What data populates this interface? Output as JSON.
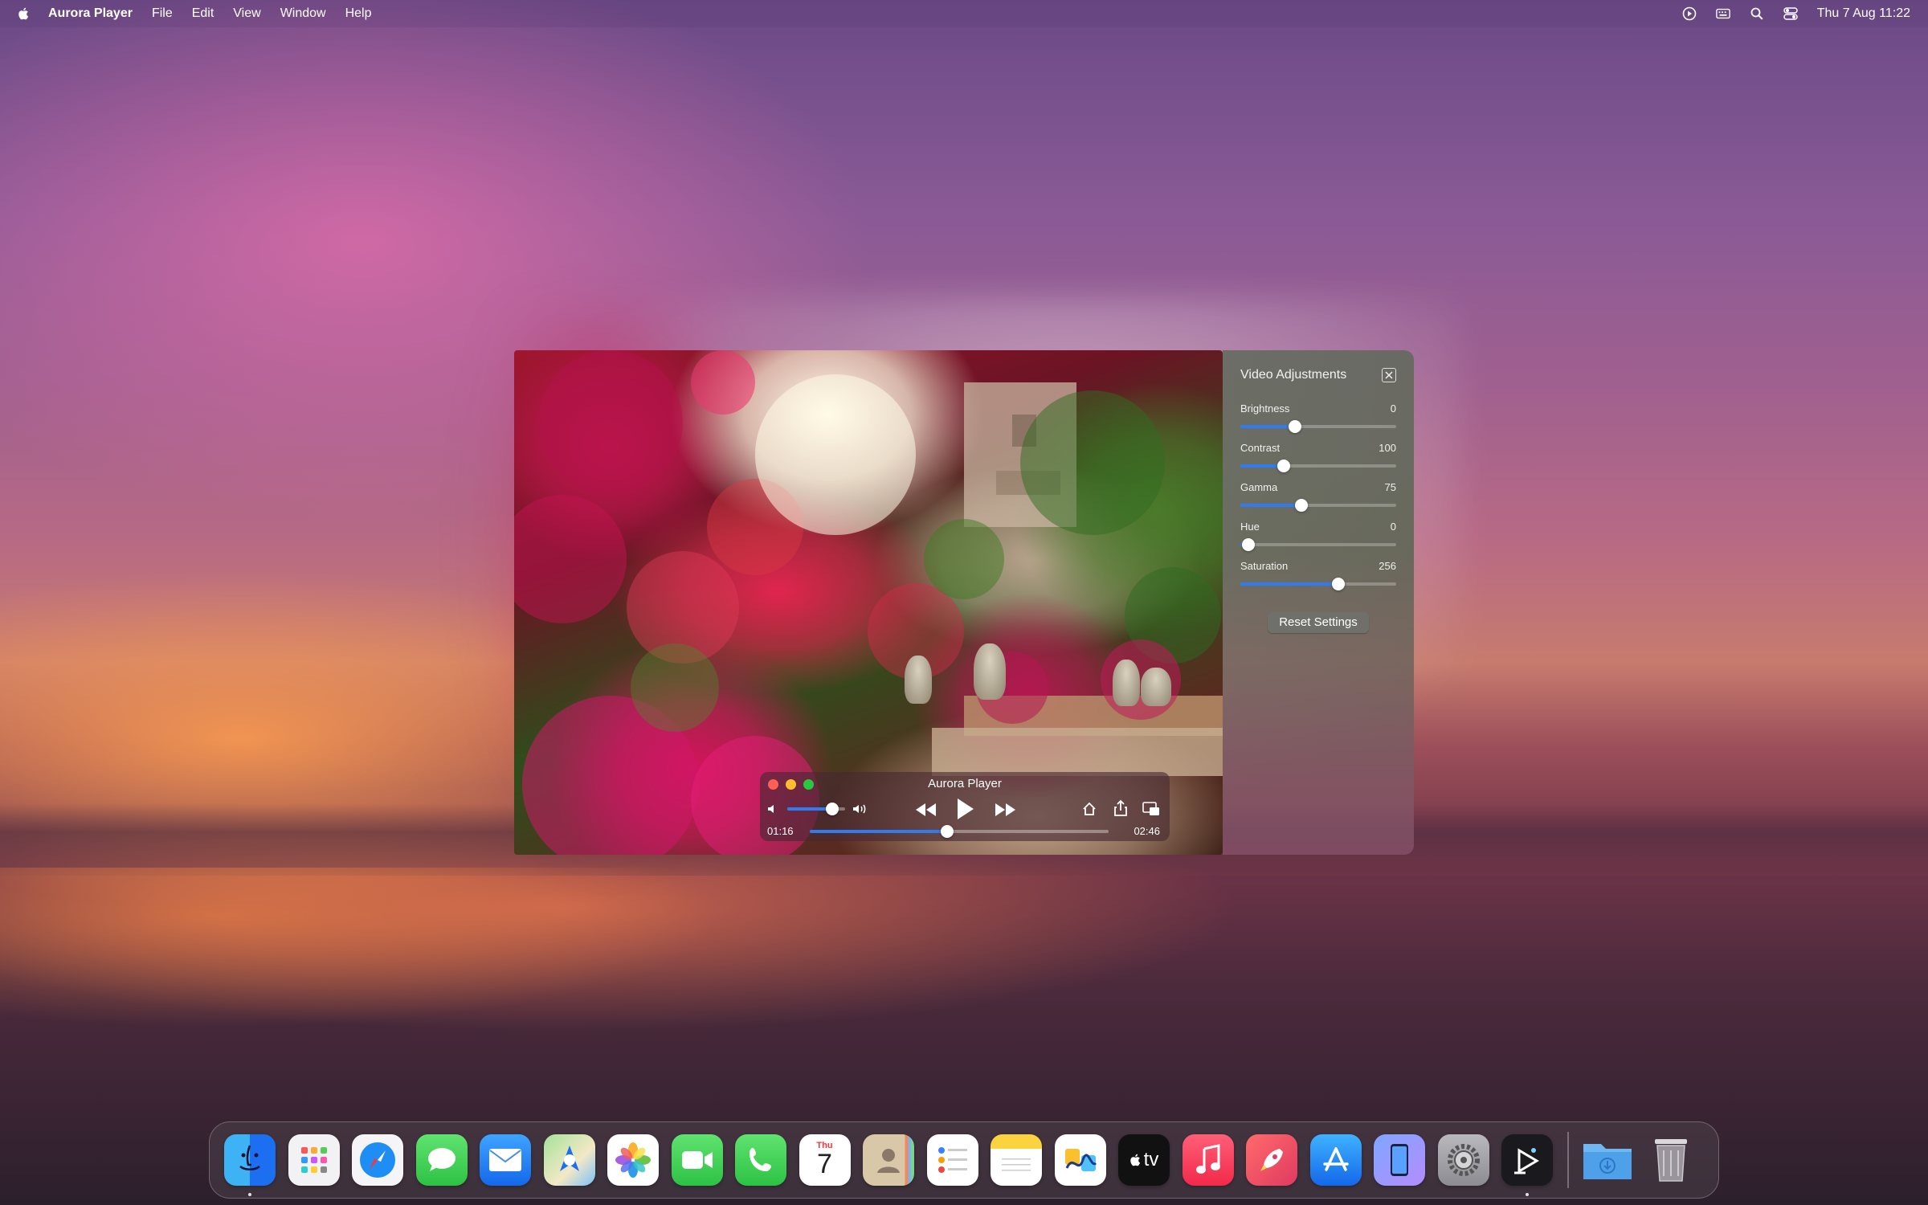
{
  "menubar": {
    "app_name": "Aurora Player",
    "menus": [
      "File",
      "Edit",
      "View",
      "Window",
      "Help"
    ],
    "clock": "Thu 7 Aug 11:22",
    "status_icons": [
      "play-circle-icon",
      "keyboard-icon",
      "search-icon",
      "control-center-icon"
    ]
  },
  "player": {
    "title": "Aurora Player",
    "elapsed": "01:16",
    "duration": "02:46",
    "progress_fraction": 0.46,
    "volume_fraction": 0.78
  },
  "adjustments": {
    "title": "Video Adjustments",
    "items": [
      {
        "label": "Brightness",
        "value": "0",
        "fraction": 0.35
      },
      {
        "label": "Contrast",
        "value": "100",
        "fraction": 0.28
      },
      {
        "label": "Gamma",
        "value": "75",
        "fraction": 0.39
      },
      {
        "label": "Hue",
        "value": "0",
        "fraction": 0.05
      },
      {
        "label": "Saturation",
        "value": "256",
        "fraction": 0.63
      }
    ],
    "reset_label": "Reset Settings"
  },
  "dock": {
    "apps": [
      "Finder",
      "Launchpad",
      "Safari",
      "Messages",
      "Mail",
      "Maps",
      "Photos",
      "FaceTime",
      "Phone",
      "Calendar",
      "Contacts",
      "Reminders",
      "Notes",
      "Freeform",
      "TV",
      "Music",
      "Rocket",
      "App Store",
      "iPhone Mirroring",
      "System Settings",
      "Aurora Player"
    ],
    "calendar_month": "Thu",
    "calendar_day": "7",
    "tv_label": "tv",
    "extras": [
      "Downloads",
      "Trash"
    ]
  },
  "colors": {
    "accent": "#2f7bf0",
    "traffic_close": "#fe5f57",
    "traffic_min": "#febc2e",
    "traffic_max": "#28c840"
  }
}
